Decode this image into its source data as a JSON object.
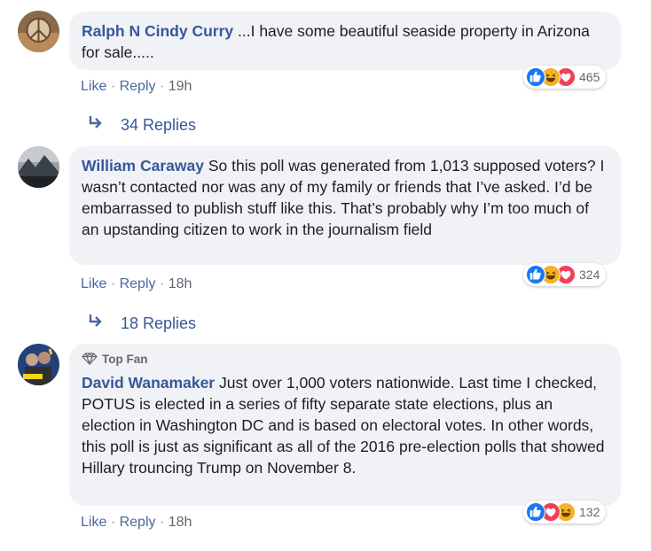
{
  "comments": [
    {
      "author": "Ralph N Cindy Curry",
      "text": "...I have some beautiful seaside property in Arizona for sale.....",
      "actions": {
        "like": "Like",
        "reply": "Reply",
        "time": "19h"
      },
      "reactions": {
        "count": "465",
        "icons": [
          "like-icon",
          "haha-icon",
          "love-icon"
        ]
      },
      "replies": "34 Replies"
    },
    {
      "author": "William Caraway",
      "text": "So this poll was generated from 1,013 supposed voters? I wasn’t contacted nor was any of my family or friends that I’ve asked. I’d be embarrassed to publish stuff like this. That’s probably why I’m too much of an upstanding citizen to work in the journalism field",
      "actions": {
        "like": "Like",
        "reply": "Reply",
        "time": "18h"
      },
      "reactions": {
        "count": "324",
        "icons": [
          "like-icon",
          "haha-icon",
          "love-icon"
        ]
      },
      "replies": "18 Replies"
    },
    {
      "badge": "Top Fan",
      "author": "David Wanamaker",
      "text": "Just over 1,000 voters nationwide. Last time I checked, POTUS is elected in a series of fifty separate state elections, plus an election in Washington DC and is based on electoral votes. In other words, this poll is just as significant as all of the 2016 pre-election polls that showed Hillary trouncing Trump on November 8.",
      "actions": {
        "like": "Like",
        "reply": "Reply",
        "time": "18h"
      },
      "reactions": {
        "count": "132",
        "icons": [
          "like-icon",
          "love-icon",
          "haha-icon"
        ]
      }
    }
  ],
  "separator": "·",
  "colors": {
    "bubble": "#f0f2f5",
    "author": "#365899",
    "like": "#1877f2",
    "haha": "#f7b125",
    "love": "#f33e58"
  }
}
